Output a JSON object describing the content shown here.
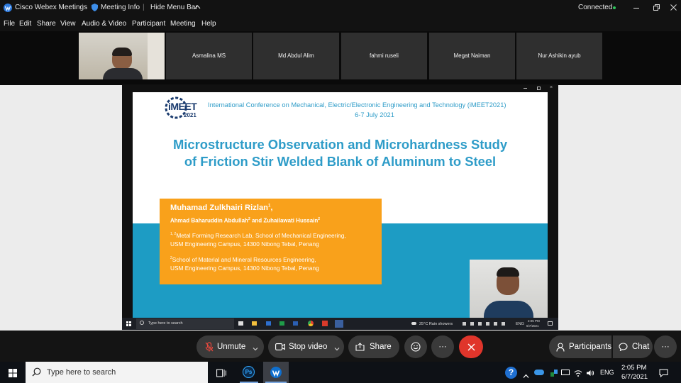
{
  "titlebar": {
    "app_name": "Cisco Webex Meetings",
    "sep1": "|",
    "meeting_info": "Meeting Info",
    "sep2": "|",
    "hide_menu": "Hide Menu Bar",
    "status": "Connected",
    "status_color": "#2ec55a"
  },
  "menu": [
    "File",
    "Edit",
    "Share",
    "View",
    "Audio & Video",
    "Participant",
    "Meeting",
    "Help"
  ],
  "participants": [
    "Asmalina MS",
    "Md Abdul Alim",
    "fahmi ruseli",
    "Megat Naiman",
    "Nur Ashikin ayub"
  ],
  "slide": {
    "logo_text": "iMEET",
    "logo_year": "2021",
    "conference": "International Conference on Mechanical, Electric/Electronic Engineering and Technology (iMEET2021)",
    "dates": "6-7 July 2021",
    "title_line1": "Microstructure Observation and Microhardness Study",
    "title_line2": "of Friction Stir Welded Blank of Aluminum to Steel",
    "author_main": "Muhamad Zulkhairi Rizlan",
    "author_main_sup": "1",
    "author_main_comma": ",",
    "coauthor1": "Ahmad Baharuddin Abdullah",
    "coauthor1_sup": "2",
    "and": " and ",
    "coauthor2": "Zuhailawati Hussain",
    "coauthor2_sup": "2",
    "aff1_sup": "1, 2",
    "aff1_line1": "Metal Forming Research Lab, School of Mechanical Engineering,",
    "aff1_line2": "USM Engineering Campus, 14300 Nibong Tebal, Penang",
    "aff2_sup": "2",
    "aff2_line1": "School of Material and Mineral Resources Engineering,",
    "aff2_line2": "USM Engineering Campus, 14300 Nibong Tebal, Penang"
  },
  "inner_taskbar": {
    "search": "Type here to search",
    "weather": "25°C  Rain showers",
    "lang": "ENG",
    "time": "2:05 PM",
    "date": "6/7/2021"
  },
  "controls": {
    "unmute": "Unmute",
    "stop_video": "Stop video",
    "share": "Share",
    "participants": "Participants",
    "chat": "Chat",
    "more": "···",
    "leave_color": "#e0352b"
  },
  "taskbar": {
    "search_placeholder": "Type here to search",
    "lang": "ENG",
    "time": "2:05 PM",
    "date": "6/7/2021",
    "ps_label": "Ps"
  },
  "colors": {
    "slide_title": "#2e9cc8",
    "slide_band": "#1d9cc4",
    "author_box": "#f9a11b"
  }
}
